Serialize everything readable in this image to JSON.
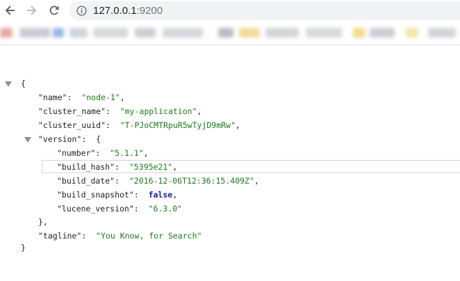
{
  "browser": {
    "url_host": "127.0.0.1",
    "url_port": ":9200",
    "icons": {
      "back": "back-arrow-icon",
      "forward": "forward-arrow-icon",
      "reload": "reload-icon",
      "site_info": "info-icon"
    }
  },
  "colors": {
    "string": "#1b7a1b",
    "boolean": "#1a1aa6",
    "omnibox_bg": "#f1f3f4"
  },
  "json": {
    "open_brace": "{",
    "close_brace": "}",
    "name": {
      "key": "\"name\"",
      "value": "\"node-1\""
    },
    "cluster_name": {
      "key": "\"cluster_name\"",
      "value": "\"my-application\""
    },
    "cluster_uuid": {
      "key": "\"cluster_uuid\"",
      "value": "\"T-PJoCMTRpuR5wTyjD9mRw\""
    },
    "version": {
      "key": "\"version\"",
      "open": "{",
      "close": "},",
      "number": {
        "key": "\"number\"",
        "value": "\"5.1.1\""
      },
      "build_hash": {
        "key": "\"build_hash\"",
        "value": "\"5395e21\""
      },
      "build_date": {
        "key": "\"build_date\"",
        "value": "\"2016-12-06T12:36:15.409Z\""
      },
      "build_snapshot": {
        "key": "\"build_snapshot\"",
        "value": "false"
      },
      "lucene_version": {
        "key": "\"lucene_version\"",
        "value": "\"6.3.0\""
      }
    },
    "tagline": {
      "key": "\"tagline\"",
      "value": "\"You Know, for Search\""
    }
  }
}
